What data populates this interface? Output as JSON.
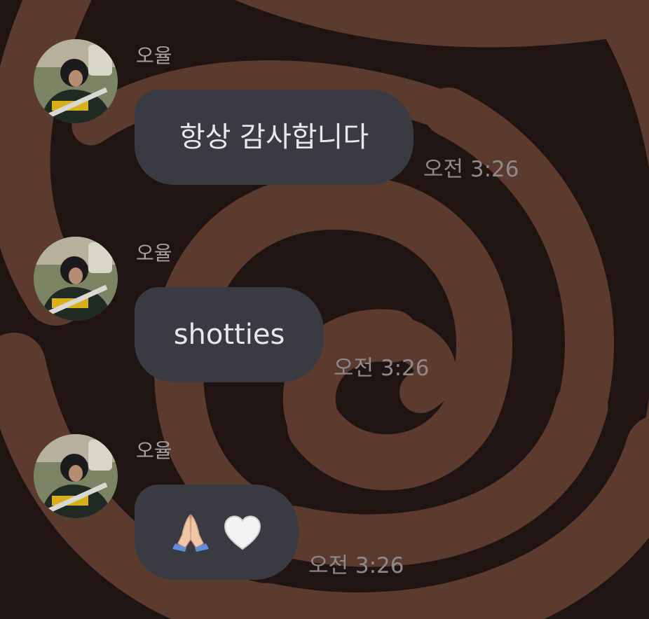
{
  "chat": {
    "messages": [
      {
        "sender": "오율",
        "text": "항상 감사합니다",
        "time": "오전 3:26"
      },
      {
        "sender": "오율",
        "text": "shotties",
        "time": "오전 3:26"
      },
      {
        "sender": "오율",
        "emojis": [
          "folded-hands-icon",
          "white-heart-icon"
        ],
        "time": "오전 3:26"
      }
    ]
  },
  "colors": {
    "bubble": "#3a3b42",
    "background_dark": "#1f1412",
    "background_swirl": "#5a3b2e",
    "timestamp": "#8e8a8b",
    "sender": "#a7a0a0"
  }
}
